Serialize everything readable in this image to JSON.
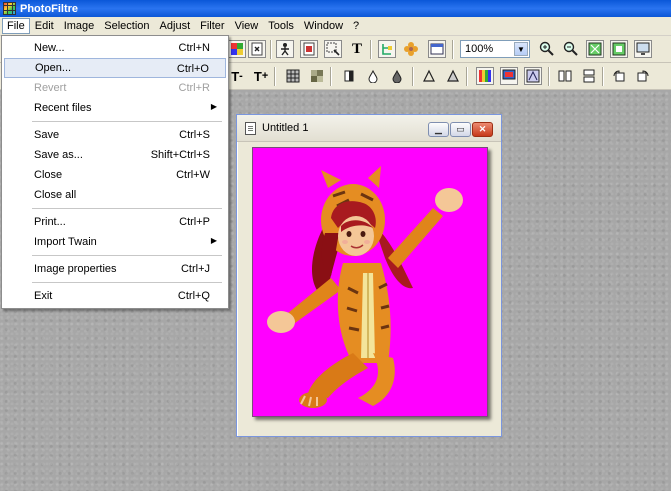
{
  "app": {
    "title": "PhotoFiltre"
  },
  "menubar": [
    "File",
    "Edit",
    "Image",
    "Selection",
    "Adjust",
    "Filter",
    "View",
    "Tools",
    "Window",
    "?"
  ],
  "toolbar": {
    "zoom_value": "100%"
  },
  "file_menu": {
    "items": [
      {
        "label": "New...",
        "shortcut": "Ctrl+N"
      },
      {
        "label": "Open...",
        "shortcut": "Ctrl+O",
        "highlighted": true
      },
      {
        "label": "Revert",
        "shortcut": "Ctrl+R",
        "disabled": true
      },
      {
        "label": "Recent files",
        "submenu": true
      },
      {
        "label": "Save",
        "shortcut": "Ctrl+S"
      },
      {
        "label": "Save as...",
        "shortcut": "Shift+Ctrl+S"
      },
      {
        "label": "Close",
        "shortcut": "Ctrl+W"
      },
      {
        "label": "Close all"
      },
      {
        "label": "Print...",
        "shortcut": "Ctrl+P"
      },
      {
        "label": "Import Twain",
        "submenu": true
      },
      {
        "label": "Image properties",
        "shortcut": "Ctrl+J"
      },
      {
        "label": "Exit",
        "shortcut": "Ctrl+Q"
      }
    ]
  },
  "image_window": {
    "title": "Untitled 1",
    "background_color": "#ff00ff"
  },
  "colors": {
    "titlebar": "#0a57d8",
    "accent_highlight": "#e6ecf6",
    "canvas": "#ff00ff"
  }
}
